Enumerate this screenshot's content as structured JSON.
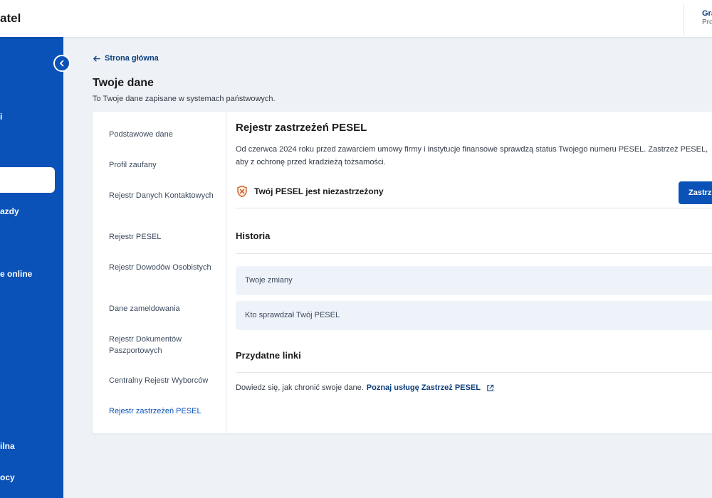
{
  "header": {
    "brand": "atel",
    "user_name": "Gra",
    "user_role": "Pro"
  },
  "sidebar": {
    "items": [
      {
        "label": ""
      },
      {
        "label": "i"
      },
      {
        "label": ""
      },
      {
        "label": "azdy"
      },
      {
        "label": "e online"
      },
      {
        "label": "ilna"
      },
      {
        "label": "ocy"
      }
    ]
  },
  "breadcrumb": {
    "back_label": "Strona główna"
  },
  "page": {
    "title": "Twoje dane",
    "subtitle": "To Twoje dane zapisane w systemach państwowych."
  },
  "left_nav": {
    "items": [
      {
        "label": "Podstawowe dane"
      },
      {
        "label": "Profil zaufany"
      },
      {
        "label": "Rejestr Danych Kontaktowych"
      },
      {
        "label": "Rejestr PESEL"
      },
      {
        "label": "Rejestr Dowodów Osobistych"
      },
      {
        "label": "Dane zameldowania"
      },
      {
        "label": "Rejestr Dokumentów Paszportowych"
      },
      {
        "label": "Centralny Rejestr Wyborców"
      },
      {
        "label": "Rejestr zastrzeżeń PESEL"
      }
    ],
    "active_index": 8
  },
  "content": {
    "title": "Rejestr zastrzeżeń PESEL",
    "description": "Od czerwca 2024 roku przed zawarciem umowy firmy i instytucje finansowe sprawdzą status Twojego numeru PESEL. Zastrzeż PESEL, aby z ochronę przed kradzieżą tożsamości.",
    "status_text": "Twój PESEL jest niezastrzeżony",
    "status_icon": "shield-x-icon",
    "button_label": "Zastrz",
    "history_title": "Historia",
    "accordions": [
      {
        "label": "Twoje zmiany"
      },
      {
        "label": "Kto sprawdzał Twój PESEL"
      }
    ],
    "links_title": "Przydatne linki",
    "links_text": "Dowiedz się, jak chronić swoje dane.",
    "link_label": "Poznaj usługę Zastrzeż PESEL"
  },
  "colors": {
    "primary": "#0a52b8",
    "link": "#0b3e7a",
    "background": "#eef2f7",
    "status_icon": "#c8541a"
  }
}
